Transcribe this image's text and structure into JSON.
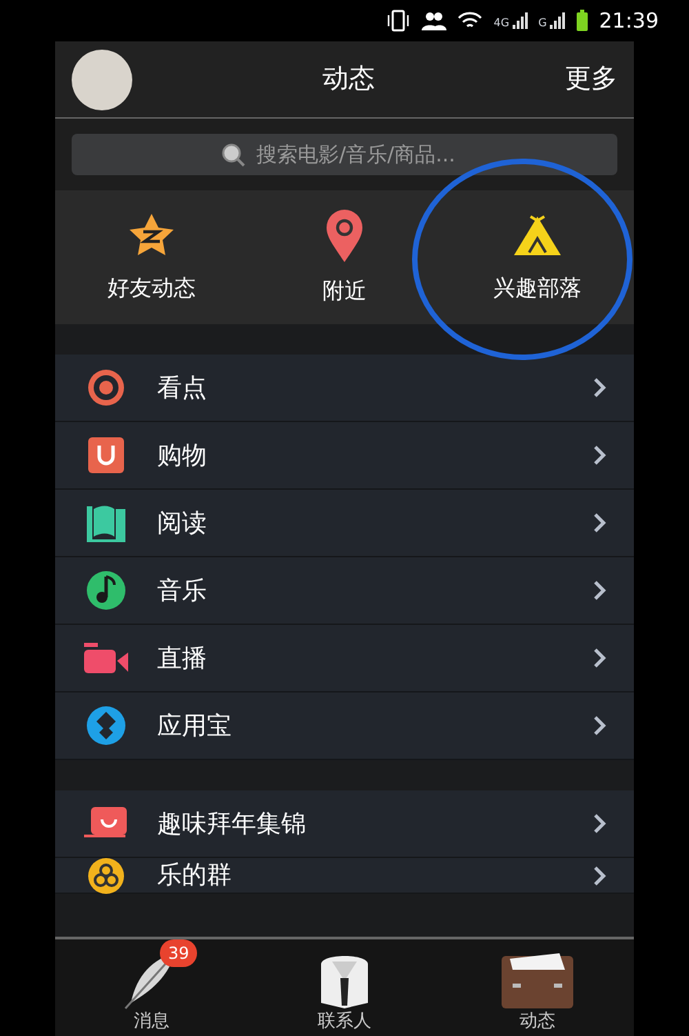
{
  "status_bar": {
    "network_labels": [
      "4G",
      "G"
    ],
    "time": "21:39"
  },
  "header": {
    "title": "动态",
    "more": "更多"
  },
  "search": {
    "placeholder": "搜索电影/音乐/商品..."
  },
  "quick_links": [
    {
      "kind": "star",
      "label": "好友动态"
    },
    {
      "kind": "pin",
      "label": "附近"
    },
    {
      "kind": "tent",
      "label": "兴趣部落"
    }
  ],
  "menu_groups": [
    [
      {
        "kind": "eye",
        "label": "看点"
      },
      {
        "kind": "bag",
        "label": "购物"
      },
      {
        "kind": "book",
        "label": "阅读"
      },
      {
        "kind": "music",
        "label": "音乐"
      },
      {
        "kind": "video",
        "label": "直播"
      },
      {
        "kind": "app",
        "label": "应用宝"
      }
    ],
    [
      {
        "kind": "greeting",
        "label": "趣味拜年集锦"
      },
      {
        "kind": "group",
        "label": "乐的群"
      }
    ]
  ],
  "tab_bar": [
    {
      "kind": "feather",
      "label": "消息",
      "badge": "39"
    },
    {
      "kind": "shirt",
      "label": "联系人"
    },
    {
      "kind": "case",
      "label": "动态"
    }
  ]
}
